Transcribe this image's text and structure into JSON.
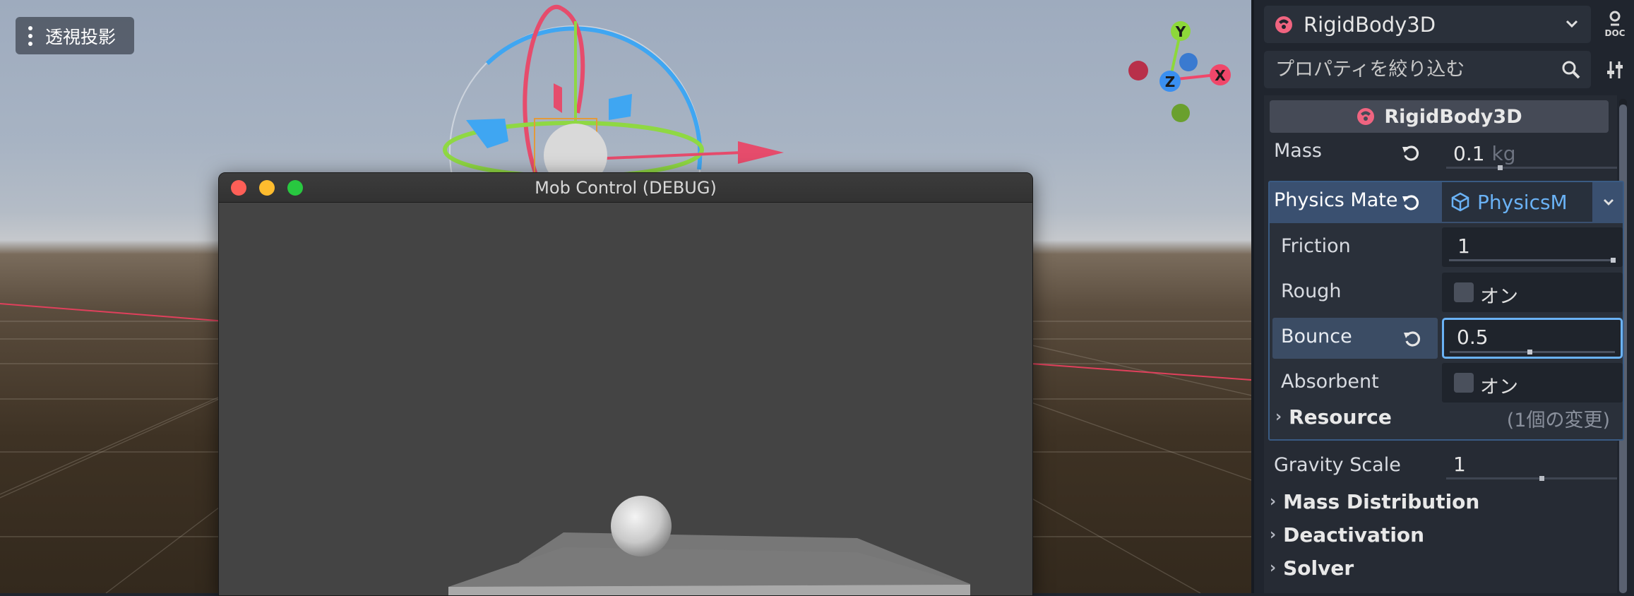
{
  "viewport": {
    "view_menu_label": "透視投影",
    "gizmo": {
      "y": "Y",
      "x": "X",
      "z": "Z"
    }
  },
  "debug_window": {
    "title": "Mob Control (DEBUG)"
  },
  "inspector": {
    "node_selector": "RigidBody3D",
    "filter_placeholder": "プロパティを絞り込む",
    "category": "RigidBody3D",
    "mass": {
      "label": "Mass",
      "value": "0.1",
      "unit": "kg",
      "fill": 0.35
    },
    "physics_material": {
      "label": "Physics Mate",
      "resource": "PhysicsM",
      "friction": {
        "label": "Friction",
        "value": "1",
        "fill": 1.0
      },
      "rough": {
        "label": "Rough",
        "checkbox_label": "オン"
      },
      "bounce": {
        "label": "Bounce",
        "value": "0.5",
        "fill": 0.5
      },
      "absorbent": {
        "label": "Absorbent",
        "checkbox_label": "オン"
      },
      "resource_section": {
        "label": "Resource",
        "changes": "(1個の変更)"
      }
    },
    "gravity_scale": {
      "label": "Gravity Scale",
      "value": "1",
      "fill": 0.6
    },
    "sections": [
      "Mass Distribution",
      "Deactivation",
      "Solver"
    ]
  },
  "colors": {
    "accent_blue": "#6ab2f5",
    "x_axis": "#f0476a",
    "y_axis": "#8dd83a",
    "z_axis": "#3a8ff0",
    "inspector_bg": "#20252e"
  }
}
